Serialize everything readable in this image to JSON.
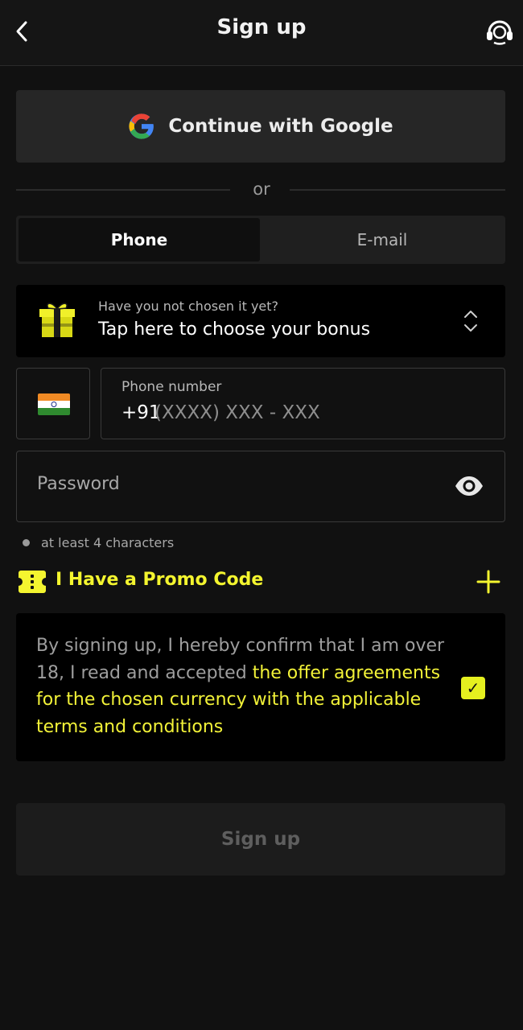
{
  "header": {
    "title": "Sign up",
    "back_icon": "chevron-left-icon",
    "support_icon": "headset-support-icon"
  },
  "google": {
    "label": "Continue with Google",
    "icon": "google-logo-icon"
  },
  "divider": {
    "text": "or"
  },
  "tabs": [
    {
      "label": "Phone",
      "active": true
    },
    {
      "label": "E-mail",
      "active": false
    }
  ],
  "bonus": {
    "caption": "Have you not chosen it yet?",
    "title": "Tap here to choose your bonus",
    "icon": "gift-box-icon",
    "chevron_icon": "chevron-up-down-icon"
  },
  "phone": {
    "country_flag": "india-flag-icon",
    "label": "Phone number",
    "prefix": "+91",
    "placeholder": "(XXXX) XXX - XXX"
  },
  "password": {
    "placeholder": "Password",
    "eye_icon": "eye-icon",
    "hint": "at least 4 characters"
  },
  "promo": {
    "label": "I Have a Promo Code",
    "icon": "ticket-icon",
    "plus_icon": "plus-icon"
  },
  "terms": {
    "text_plain": "By signing up, I hereby confirm that I am over 18, I read and accepted ",
    "text_link": "the offer agreements for the chosen currency with the applicable terms and conditions",
    "checked": true,
    "check_mark": "✓"
  },
  "submit": {
    "label": "Sign up"
  },
  "colors": {
    "accent": "#f4f52f",
    "background": "#111111",
    "surface": "#262626"
  }
}
